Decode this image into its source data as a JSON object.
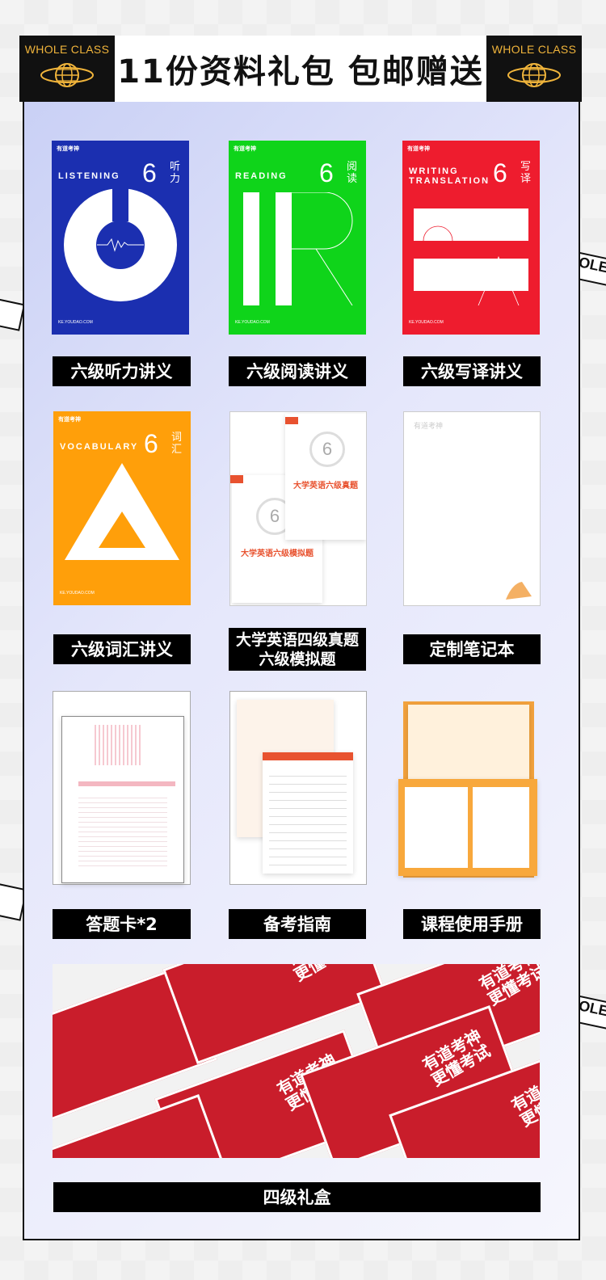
{
  "header": {
    "title": "11份资料礼包 包邮赠送",
    "brand_left": "WHOLE CLASS",
    "brand_right": "WHOLE CLASS"
  },
  "side_strips": [
    "OLE",
    "OLE"
  ],
  "covers": {
    "listening": {
      "logo": "有道考神",
      "en": "LISTENING",
      "num": "6",
      "cn": "听力",
      "foot": "KE.YOUDAO.COM",
      "color": "#1b2fb0"
    },
    "reading": {
      "logo": "有道考神",
      "en": "READING",
      "num": "6",
      "cn": "阅读",
      "foot": "KE.YOUDAO.COM",
      "color": "#0fd41a"
    },
    "writing": {
      "logo": "有道考神",
      "en": "WRITING TRANSLATION",
      "num": "6",
      "cn": "写译",
      "foot": "KE.YOUDAO.COM",
      "color": "#ee1c2e"
    },
    "vocabulary": {
      "logo": "有道考神",
      "en": "VOCABULARY",
      "num": "6",
      "cn": "词汇",
      "foot": "KE.YOUDAO.COM",
      "color": "#ff9f0a"
    },
    "exam_books": {
      "book1": "大学英语六级真题",
      "book2": "大学英语六级模拟题",
      "badge": "6"
    },
    "notebook": {
      "brand": "有道考神"
    }
  },
  "labels": {
    "listening": "六级听力讲义",
    "reading": "六级阅读讲义",
    "writing": "六级写译讲义",
    "vocabulary": "六级词汇讲义",
    "exams_line1": "大学英语四级真题",
    "exams_line2": "六级模拟题",
    "notebook": "定制笔记本",
    "answer_card": "答题卡*2",
    "guide": "备考指南",
    "manual": "课程使用手册",
    "giftbox": "四级礼盒"
  },
  "giftbox": {
    "slogan_line1": "有道考神",
    "slogan_line2": "更懂考试"
  },
  "colors": {
    "accent": "#f0b43b",
    "dark": "#111111",
    "red": "#c91d2b"
  }
}
